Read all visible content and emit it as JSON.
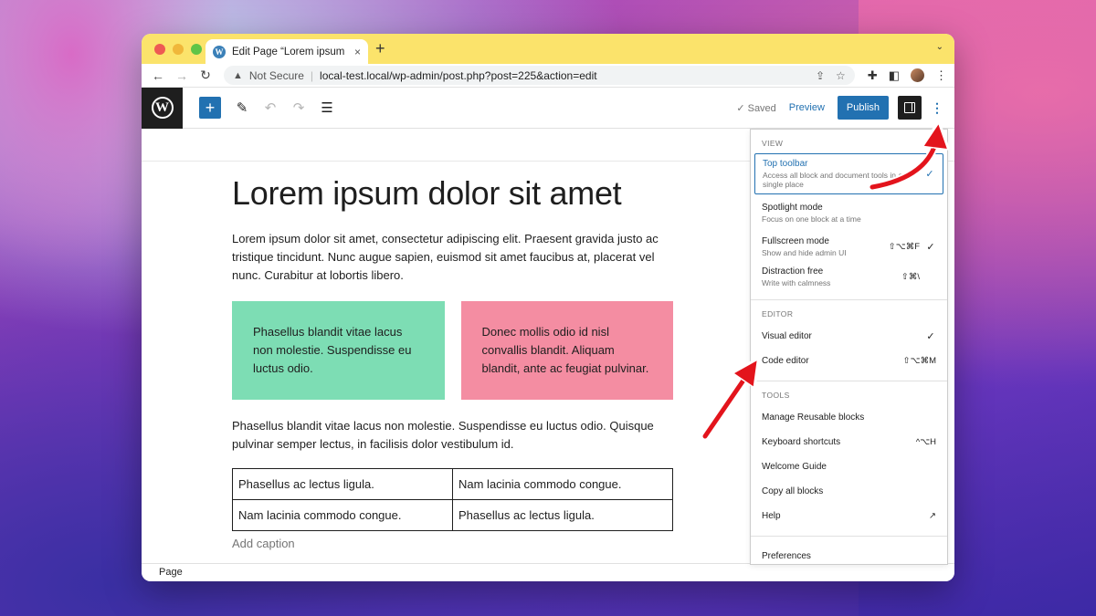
{
  "browser": {
    "tab_title": "Edit Page “Lorem ipsum dolor",
    "tab_close": "×",
    "new_tab": "+",
    "tab_menu": "⌄",
    "not_secure": "Not Secure",
    "url": "local-test.local/wp-admin/post.php?post=225&action=edit"
  },
  "toolbar": {
    "inserter": "+",
    "saved": "✓ Saved",
    "preview": "Preview",
    "publish": "Publish",
    "more": "⋮"
  },
  "post": {
    "title": "Lorem ipsum dolor sit amet",
    "paragraph1": "Lorem ipsum dolor sit amet, consectetur adipiscing elit. Praesent gravida justo ac tristique tincidunt. Nunc augue sapien, euismod sit amet faucibus at, placerat vel nunc. Curabitur at lobortis libero.",
    "column_left": "Phasellus blandit vitae lacus non molestie. Suspendisse eu luctus odio.",
    "column_right": "Donec mollis odio id nisl convallis blandit. Aliquam blandit, ante ac feugiat pulvinar.",
    "paragraph2": "Phasellus blandit vitae lacus non molestie. Suspendisse eu luctus odio. Quisque pulvinar semper lectus, in facilisis dolor vestibulum id.",
    "table": [
      [
        "Phasellus ac lectus ligula.",
        "Nam lacinia commodo congue."
      ],
      [
        "Nam lacinia commodo congue.",
        "Phasellus ac lectus ligula."
      ]
    ],
    "caption_placeholder": "Add caption"
  },
  "footer": {
    "breadcrumb": "Page"
  },
  "menu": {
    "view_label": "VIEW",
    "view": [
      {
        "label": "Top toolbar",
        "desc": "Access all block and document tools in a single place",
        "shortcut": "",
        "check": "✓"
      },
      {
        "label": "Spotlight mode",
        "desc": "Focus on one block at a time",
        "shortcut": "",
        "check": ""
      },
      {
        "label": "Fullscreen mode",
        "desc": "Show and hide admin UI",
        "shortcut": "⇧⌥⌘F",
        "check": "✓"
      },
      {
        "label": "Distraction free",
        "desc": "Write with calmness",
        "shortcut": "⇧⌘\\",
        "check": ""
      }
    ],
    "editor_label": "EDITOR",
    "editor": [
      {
        "label": "Visual editor",
        "shortcut": "",
        "check": "✓"
      },
      {
        "label": "Code editor",
        "shortcut": "⇧⌥⌘M",
        "check": ""
      }
    ],
    "tools_label": "TOOLS",
    "tools": [
      {
        "label": "Manage Reusable blocks",
        "shortcut": ""
      },
      {
        "label": "Keyboard shortcuts",
        "shortcut": "^⌥H"
      },
      {
        "label": "Welcome Guide",
        "shortcut": ""
      },
      {
        "label": "Copy all blocks",
        "shortcut": ""
      },
      {
        "label": "Help",
        "shortcut": "↗"
      }
    ],
    "preferences": "Preferences"
  },
  "colors": {
    "accent": "#2271b1",
    "tab_strip": "#fbe36b",
    "column_green": "#7dddb4",
    "column_pink": "#f48da2",
    "arrow": "#e3141c"
  }
}
